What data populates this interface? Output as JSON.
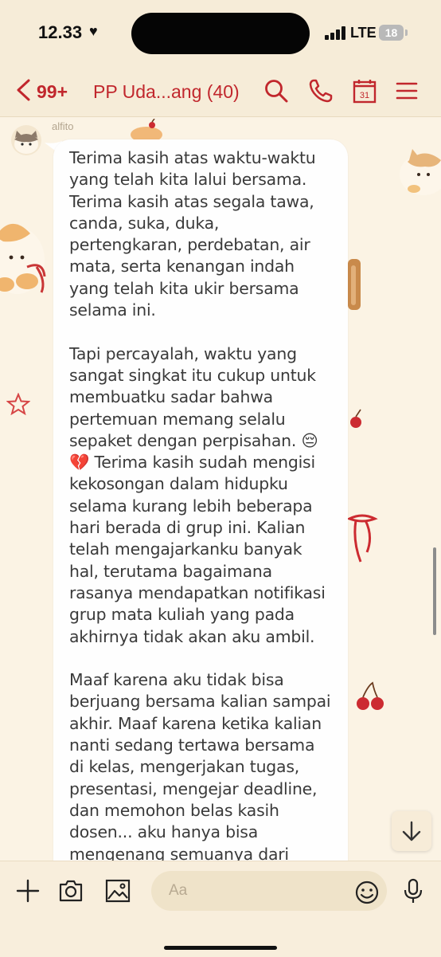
{
  "status_bar": {
    "time": "12.33",
    "network": "LTE",
    "battery": "18"
  },
  "header": {
    "unread_count": "99+",
    "chat_title": "PP Uda...ang (40)",
    "calendar_day": "31"
  },
  "chat": {
    "sender": "alfito",
    "message": "Terima kasih atas waktu-waktu yang telah kita lalui bersama. Terima kasih atas segala tawa, canda, suka, duka, pertengkaran, perdebatan, air mata, serta kenangan indah yang telah kita ukir bersama selama ini.\n\nTapi percayalah, waktu yang sangat singkat itu cukup untuk membuatku sadar bahwa pertemuan memang selalu sepaket dengan perpisahan. 😔 💔 Terima kasih sudah mengisi kekosongan dalam hidupku selama kurang lebih beberapa hari berada di grup ini. Kalian telah mengajarkanku banyak hal, terutama bagaimana rasanya mendapatkan notifikasi grup mata kuliah yang pada akhirnya tidak akan aku ambil.\n\nMaaf karena aku tidak bisa berjuang bersama kalian sampai akhir. Maaf karena ketika kalian nanti sedang tertawa bersama di kelas, mengerjakan tugas, presentasi, mengejar deadline, dan memohon belas kasih dosen... aku hanya bisa mengenang semuanya dari kejauhan sambil tetap"
  },
  "input": {
    "placeholder": "Aa"
  },
  "colors": {
    "accent": "#c1272d",
    "background": "#fbf3e4",
    "bar": "#f6ecd8"
  },
  "icons": [
    "chevron-left-icon",
    "search-icon",
    "phone-icon",
    "calendar-icon",
    "menu-icon",
    "plus-icon",
    "camera-icon",
    "image-icon",
    "emoji-icon",
    "microphone-icon",
    "arrow-down-icon"
  ]
}
